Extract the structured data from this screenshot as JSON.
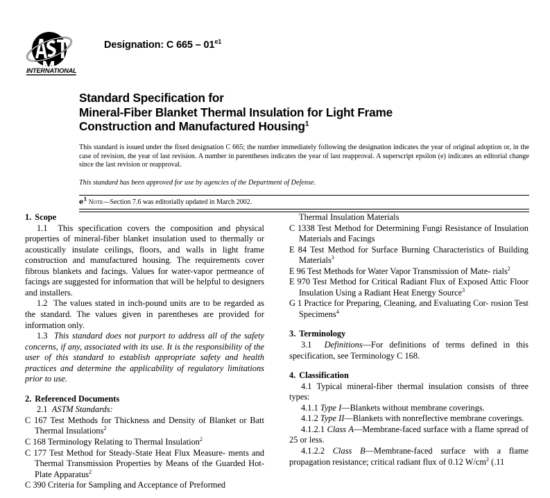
{
  "masthead": {
    "logo_name": "astm-international-logo",
    "logo_wordmark": "INTERNATIONAL",
    "designation_label": "Designation: C 665 – 01",
    "designation_superscript": "e1"
  },
  "title": {
    "line1": "Standard Specification for",
    "line2": "Mineral-Fiber Blanket Thermal Insulation for Light Frame",
    "line3": "Construction and Manufactured Housing",
    "line3_superscript": "1"
  },
  "frontmatter": {
    "issuance_paragraph": "This standard is issued under the fixed designation C 665; the number immediately following the designation indicates the year of original adoption or, in the case of revision, the year of last revision. A number in parentheses indicates the year of last reapproval. A superscript epsilon (e) indicates an editorial change since the last revision or reapproval.",
    "dod_statement": "This standard has been approved for use by agencies of the Department of Defense.",
    "editorial_note": {
      "epsilon": "e",
      "epsilon_superscript": "1",
      "note_word": "Note",
      "note_text": "—Section 7.6 was editorially updated in March 2002."
    }
  },
  "left_column": {
    "section1": {
      "number": "1.",
      "heading": "Scope",
      "paragraphs": [
        {
          "number": "1.1",
          "text": "This specification covers the composition and physical properties of mineral-fiber blanket insulation used to thermally or acoustically insulate ceilings, floors, and walls in light frame construction and manufactured housing. The requirements cover fibrous blankets and facings. Values for water-vapor permeance of facings are suggested for information that will be helpful to designers and installers."
        },
        {
          "number": "1.2",
          "text": "The values stated in inch-pound units are to be regarded as the standard. The values given in parentheses are provided for information only."
        },
        {
          "number": "1.3",
          "italic": true,
          "text": "This standard does not purport to address all of the safety concerns, if any, associated with its use. It is the responsibility of the user of this standard to establish appropriate safety and health practices and determine the applicability of regulatory limitations prior to use."
        }
      ]
    },
    "section2": {
      "number": "2.",
      "heading": "Referenced Documents",
      "subheading_number": "2.1",
      "subheading": "ASTM Standards:",
      "references": [
        {
          "lines": [
            "C 167  Test Methods for Thickness and Density of Blanket",
            "or Batt Thermal Insulations"
          ],
          "superscript": "2"
        },
        {
          "lines": [
            "C 168  Terminology Relating to Thermal Insulation"
          ],
          "superscript": "2"
        },
        {
          "lines": [
            "C 177  Test Method for Steady-State Heat Flux Measure-",
            "ments and Thermal Transmission Properties by Means of",
            "the Guarded Hot-Plate Apparatus"
          ],
          "superscript": "2"
        },
        {
          "lines": [
            "C 390  Criteria for Sampling and Acceptance of Preformed"
          ],
          "superscript": ""
        }
      ]
    }
  },
  "right_column": {
    "continued_references": [
      {
        "continuation": true,
        "lines": [
          "Thermal Insulation Materials"
        ],
        "superscript": ""
      },
      {
        "lines": [
          "C 1338  Test Method for Determining Fungi Resistance of",
          "Insulation Materials and Facings"
        ],
        "superscript": ""
      },
      {
        "lines": [
          "E 84  Test Method for Surface Burning Characteristics of",
          "Building Materials"
        ],
        "superscript": "3"
      },
      {
        "lines": [
          "E 96  Test Methods for Water Vapor Transmission of Mate-",
          "rials"
        ],
        "superscript": "2"
      },
      {
        "lines": [
          "E 970  Test Method for Critical Radiant Flux of Exposed",
          "Attic Floor Insulation Using a Radiant Heat Energy",
          "Source"
        ],
        "superscript": "3"
      },
      {
        "lines": [
          "G 1  Practice for Preparing, Cleaning, and Evaluating Cor-",
          "rosion Test Specimens"
        ],
        "superscript": "4"
      }
    ],
    "section3": {
      "number": "3.",
      "heading": "Terminology",
      "paragraph_number": "3.1",
      "paragraph_italic_lead": "Definitions",
      "paragraph_text": "—For definitions of terms defined in this specification, see Terminology C 168."
    },
    "section4": {
      "number": "4.",
      "heading": "Classification",
      "items": [
        {
          "number": "4.1",
          "text": "Typical mineral-fiber thermal insulation consists of three types:"
        },
        {
          "number": "4.1.1",
          "italic_lead": "Type I",
          "text": "—Blankets without membrane coverings."
        },
        {
          "number": "4.1.2",
          "italic_lead": "Type II",
          "text": "—Blankets with nonreflective membrane coverings."
        },
        {
          "number": "4.1.2.1",
          "italic_lead": "Class A",
          "text": "—Membrane-faced surface with a flame spread of 25 or less."
        },
        {
          "number": "4.1.2.2",
          "italic_lead": "Class B",
          "text": "—Membrane-faced surface with a flame propagation resistance; critical radiant flux of 0.12 W/cm"
        }
      ]
    }
  },
  "colors": {
    "page_background": "#ffffff",
    "text": "#000000",
    "rule": "#000000"
  }
}
